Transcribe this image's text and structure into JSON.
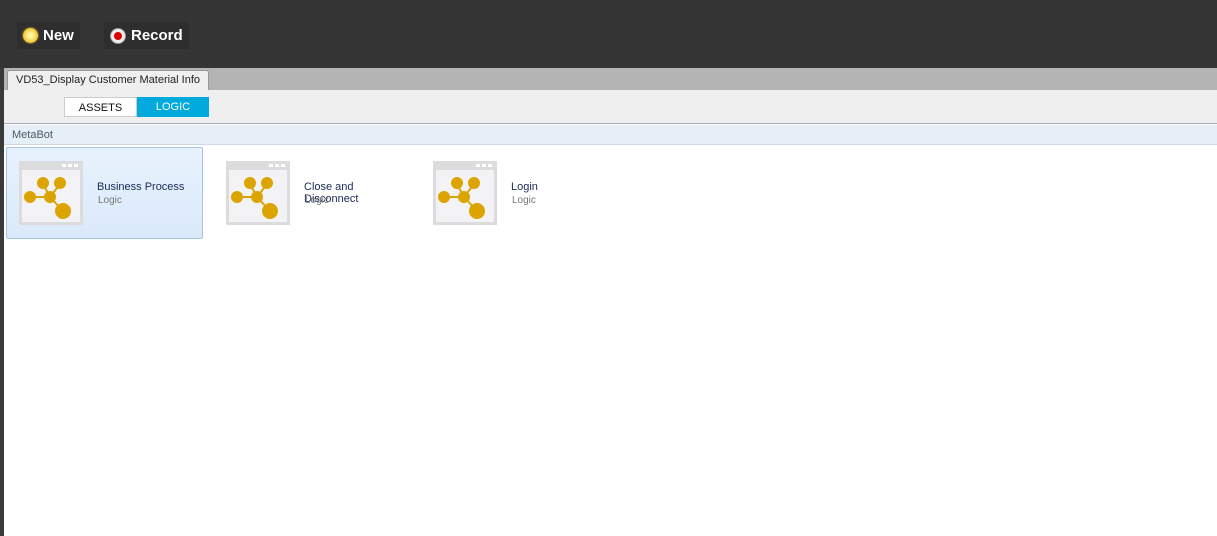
{
  "toolbar": {
    "new_label": "New",
    "record_label": "Record"
  },
  "document_tab": "VD53_Display Customer Material Info",
  "view_tabs": {
    "assets": "ASSETS",
    "logic": "LOGIC",
    "active": "LOGIC"
  },
  "section_label": "MetaBot",
  "items": [
    {
      "name": "Business Process",
      "type": "Logic",
      "selected": true
    },
    {
      "name": "Close and Disconnect",
      "type": "Logic"
    },
    {
      "name": "Login",
      "type": "Logic"
    }
  ],
  "colors": {
    "accent": "#00aadd",
    "node": "#dba400"
  }
}
